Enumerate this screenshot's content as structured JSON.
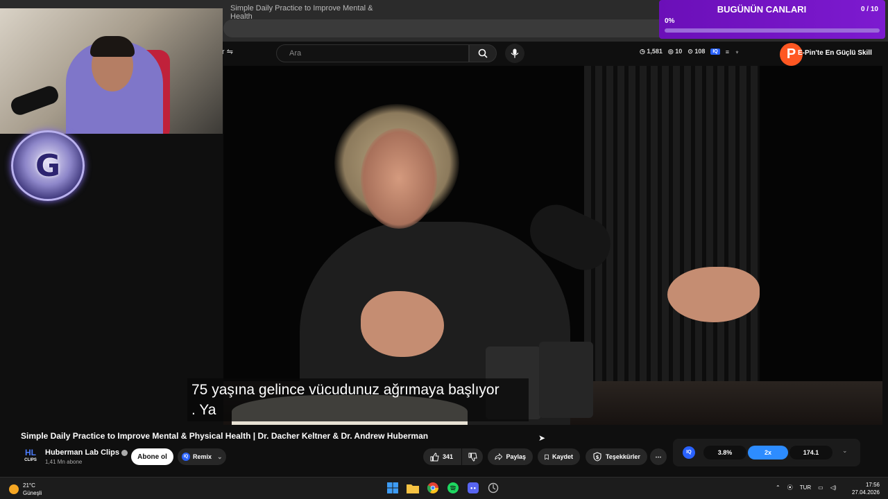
{
  "browser": {
    "tab_title": "Simple Daily Practice to Improve Mental & Health"
  },
  "youtube": {
    "search_placeholder": "Ara",
    "ext_stats": {
      "time": "1,581",
      "views": "10",
      "count": "108",
      "iq_badge": "IQ"
    },
    "ticker": "E-Pin'te En Güçlü Skill",
    "avatar_letter": "P"
  },
  "goal_widget": {
    "title": "BUGÜNÜN CANLARI",
    "count": "0 / 10",
    "percent_text": "0%",
    "progress": 0
  },
  "stream_logo": "G",
  "video": {
    "caption_line1": "75 yaşına gelince vücudunuz ağrımaya başlıyor",
    "caption_line2": ".  Ya",
    "title": "Simple Daily Practice to Improve Mental & Physical Health | Dr. Dacher Keltner & Dr. Andrew Huberman"
  },
  "channel": {
    "logo_text": "HL",
    "logo_sub": "CLIPS",
    "name": "Huberman Lab Clips",
    "subscribers": "1,41 Mn abone",
    "subscribe_label": "Abone ol",
    "remix_label": "Remix"
  },
  "actions": {
    "likes": "341",
    "share": "Paylaş",
    "save": "Kaydet",
    "thanks": "Teşekkürler",
    "more": "⋯"
  },
  "iq_panel": {
    "icon": "IQ",
    "value1": "3.8%",
    "value2": "2x",
    "value3": "174.1"
  },
  "taskbar": {
    "temperature": "21°C",
    "weather_desc": "Güneşli",
    "language": "TUR",
    "time": "17:56",
    "date": "27.04.2026"
  },
  "colors": {
    "goal_bg": "#7d1ad0",
    "accent_blue": "#2d8cff",
    "avatar_orange": "#ff5722"
  },
  "icons": [
    "search-icon",
    "mic-icon",
    "like-icon",
    "dislike-icon",
    "share-icon",
    "bookmark-icon",
    "thanks-icon",
    "windows-icon",
    "explorer-icon",
    "chrome-icon",
    "spotify-icon",
    "discord-icon",
    "app-icon"
  ]
}
